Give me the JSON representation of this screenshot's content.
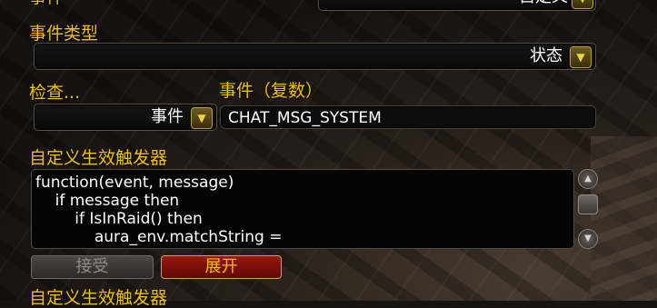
{
  "top_partial_label": "事件",
  "top_partial_value": "自定义",
  "event_type": {
    "label": "事件类型",
    "selected": "状态"
  },
  "check": {
    "label": "检查...",
    "selected": "事件"
  },
  "events": {
    "label": "事件（复数）",
    "value": "CHAT_MSG_SYSTEM"
  },
  "custom_trigger": {
    "label": "自定义生效触发器",
    "code_lines": [
      "function(event, message)",
      "    if message then",
      "        if IsInRaid() then",
      "            aura_env.matchString ="
    ],
    "accept_label": "接受",
    "expand_label": "展开"
  },
  "bottom_partial_label": "自定义生效触发器",
  "icons": {
    "dropdown": "chevron-down-icon",
    "scroll_up": "scroll-up-icon",
    "scroll_down": "scroll-down-icon"
  },
  "colors": {
    "label": "#f2c200",
    "button_red": "#9b1612"
  }
}
